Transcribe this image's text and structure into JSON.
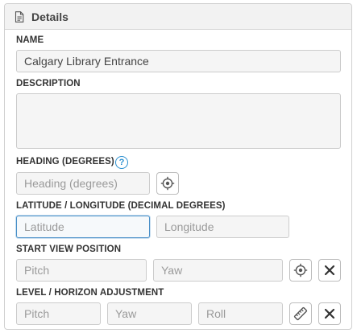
{
  "panel": {
    "title": "Details",
    "icon": "document-icon"
  },
  "name": {
    "label": "NAME",
    "value": "Calgary Library Entrance"
  },
  "description": {
    "label": "DESCRIPTION",
    "value": ""
  },
  "heading": {
    "label": "HEADING (DEGREES)",
    "help_glyph": "?",
    "placeholder": "Heading (degrees)",
    "button_icon": "crosshair-icon"
  },
  "latlng": {
    "label": "LATITUDE / LONGITUDE (DECIMAL DEGREES)",
    "latitude_placeholder": "Latitude",
    "longitude_placeholder": "Longitude"
  },
  "start_view": {
    "label": "START VIEW POSITION",
    "pitch_placeholder": "Pitch",
    "yaw_placeholder": "Yaw",
    "target_icon": "crosshair-icon",
    "clear_icon": "close-icon"
  },
  "level": {
    "label": "LEVEL / HORIZON ADJUSTMENT",
    "pitch_placeholder": "Pitch",
    "yaw_placeholder": "Yaw",
    "roll_placeholder": "Roll",
    "level_icon": "ruler-icon",
    "clear_icon": "close-icon"
  },
  "colors": {
    "focus_border": "#4a90c8",
    "help_blue": "#2a8fd0",
    "field_bg": "#f5f5f5",
    "header_bg": "#f2f2f2"
  }
}
